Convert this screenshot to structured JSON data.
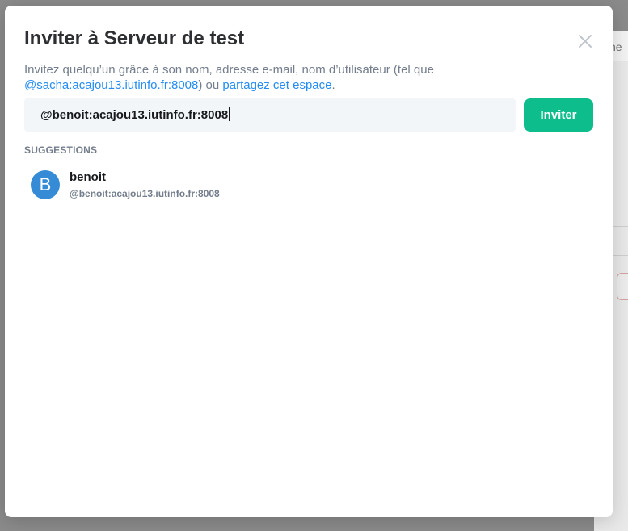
{
  "background": {
    "tab_label": "ne"
  },
  "dialog": {
    "title": "Inviter à Serveur de test",
    "close_icon": "close-icon",
    "description": {
      "prefix": "Invitez quelqu’un grâce à son nom, adresse e-mail, nom d’utilisateur (tel que ",
      "example_user": "@sacha:acajou13.iutinfo.fr:8008",
      "middle": ") ou ",
      "share_link": "partagez cet espace",
      "suffix": "."
    },
    "input": {
      "value": "@benoit:acajou13.iutinfo.fr:8008"
    },
    "invite_button": "Inviter",
    "suggestions": {
      "heading": "SUGGESTIONS",
      "items": [
        {
          "avatar_letter": "B",
          "name": "benoit",
          "user_id": "@benoit:acajou13.iutinfo.fr:8008"
        }
      ]
    }
  },
  "colors": {
    "accent": "#0dbd8b",
    "link": "#238cf5",
    "avatar": "#368bd6",
    "muted_text": "#737d8c",
    "input_bg": "#f2f6f9"
  }
}
